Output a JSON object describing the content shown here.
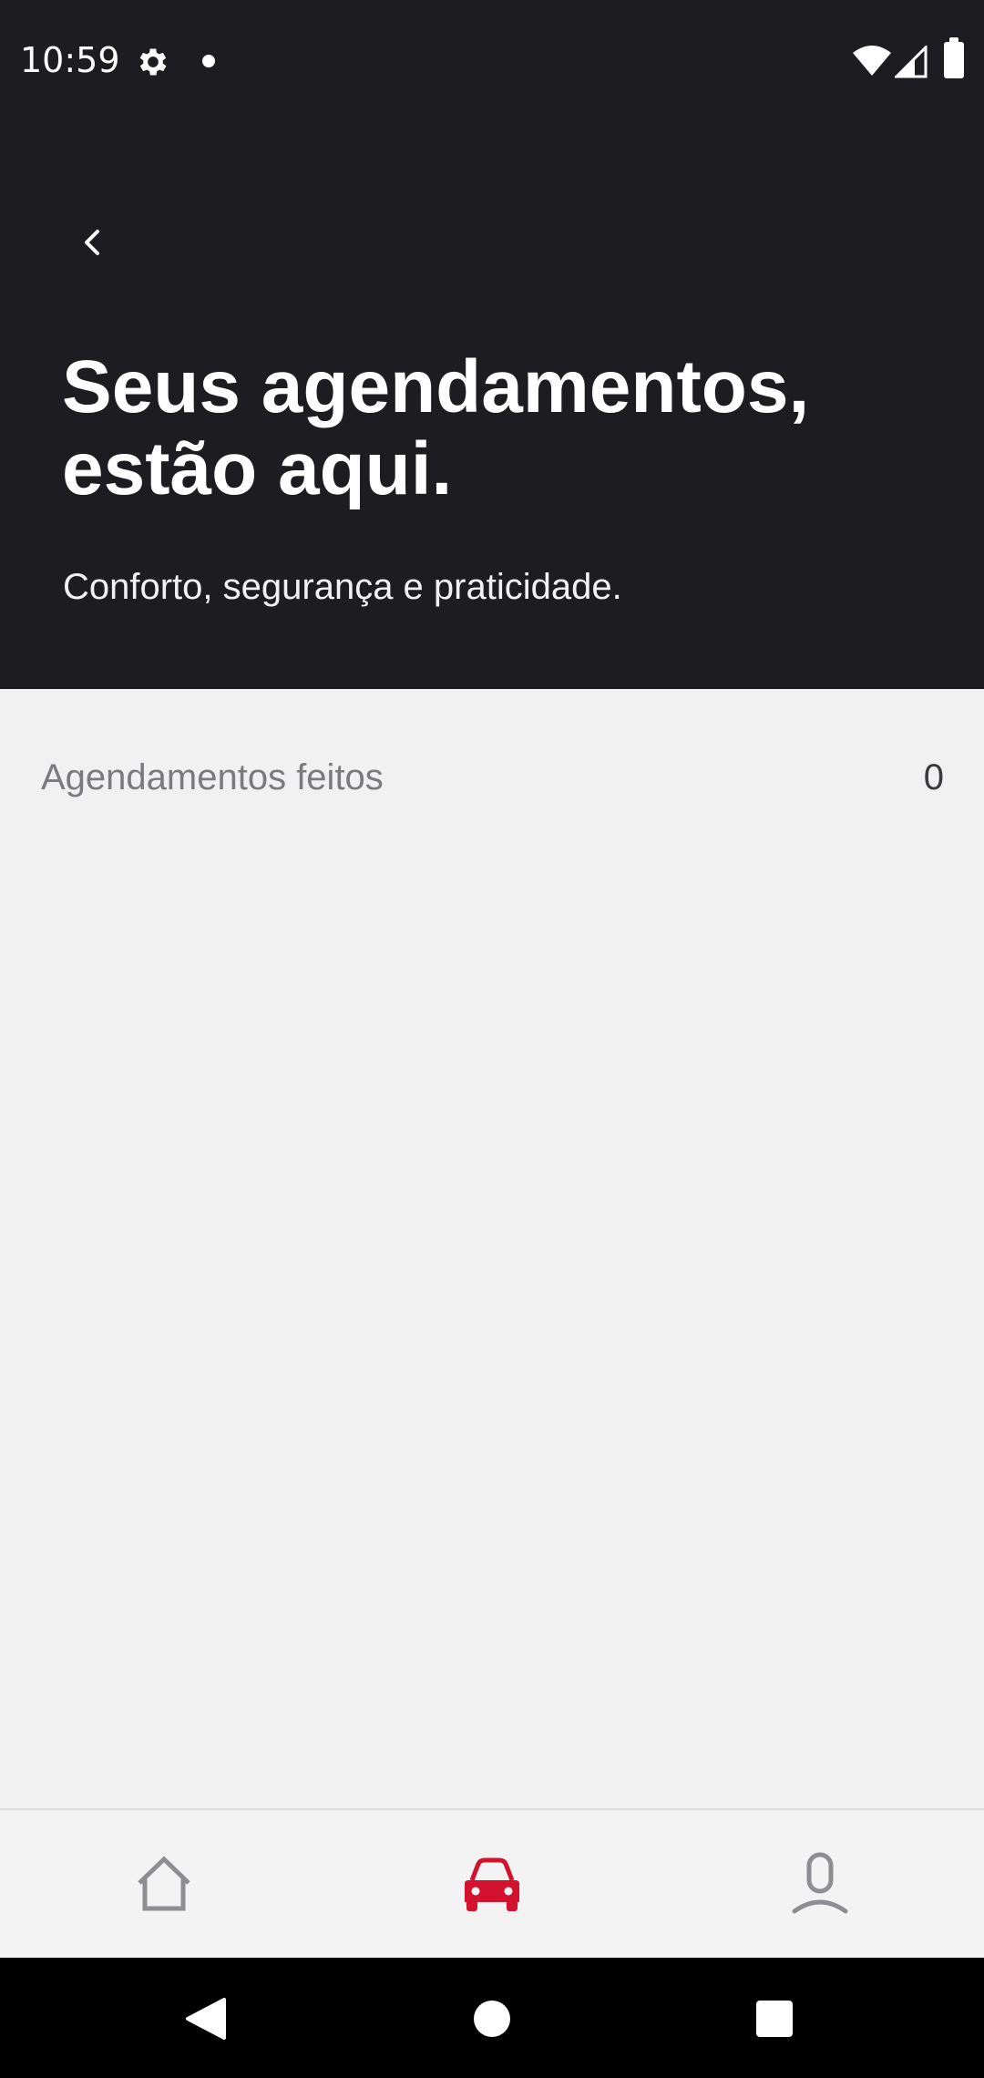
{
  "status_bar": {
    "time": "10:59",
    "icons": [
      "gear-icon",
      "notification-dot-icon",
      "wifi-icon",
      "signal-icon",
      "battery-icon"
    ]
  },
  "header": {
    "title": "Seus agendamentos, estão aqui.",
    "subtitle": "Conforto, segurança e praticidade.",
    "back_icon": "chevron-left-icon"
  },
  "summary": {
    "label": "Agendamentos feitos",
    "count": "0"
  },
  "bottom_nav": {
    "items": [
      {
        "icon": "home-icon",
        "active": false
      },
      {
        "icon": "car-icon",
        "active": true
      },
      {
        "icon": "profile-icon",
        "active": false
      }
    ]
  },
  "system_nav": {
    "icons": [
      "back-triangle-icon",
      "home-circle-icon",
      "recents-square-icon"
    ]
  },
  "colors": {
    "header_bg": "#1c1c21",
    "body_bg": "#f1f1f2",
    "accent": "#d3122d",
    "inactive_icon": "#8e8e92"
  }
}
